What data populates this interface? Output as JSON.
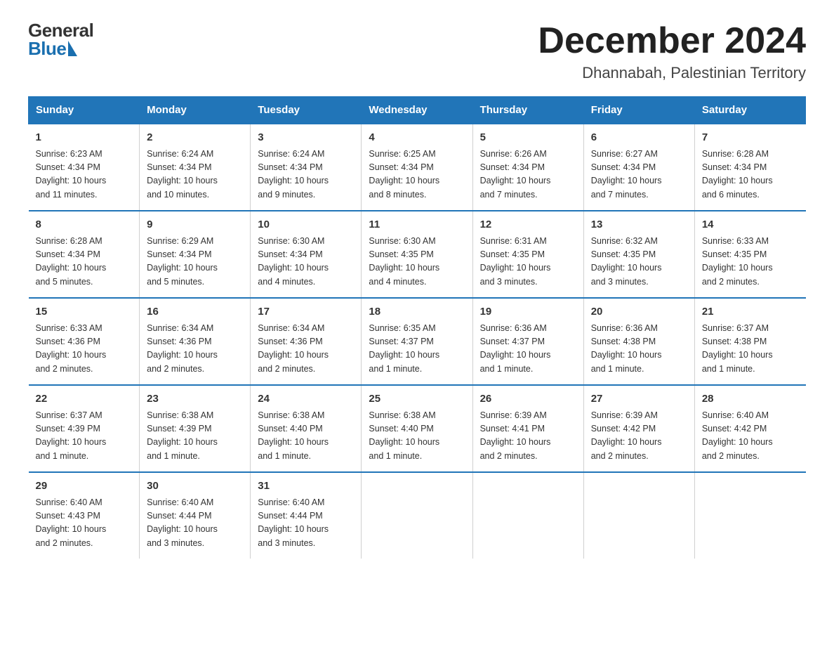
{
  "header": {
    "logo_general": "General",
    "logo_blue": "Blue",
    "month_title": "December 2024",
    "location": "Dhannabah, Palestinian Territory"
  },
  "days_of_week": [
    "Sunday",
    "Monday",
    "Tuesday",
    "Wednesday",
    "Thursday",
    "Friday",
    "Saturday"
  ],
  "weeks": [
    [
      {
        "day": "1",
        "sunrise": "6:23 AM",
        "sunset": "4:34 PM",
        "daylight": "10 hours and 11 minutes."
      },
      {
        "day": "2",
        "sunrise": "6:24 AM",
        "sunset": "4:34 PM",
        "daylight": "10 hours and 10 minutes."
      },
      {
        "day": "3",
        "sunrise": "6:24 AM",
        "sunset": "4:34 PM",
        "daylight": "10 hours and 9 minutes."
      },
      {
        "day": "4",
        "sunrise": "6:25 AM",
        "sunset": "4:34 PM",
        "daylight": "10 hours and 8 minutes."
      },
      {
        "day": "5",
        "sunrise": "6:26 AM",
        "sunset": "4:34 PM",
        "daylight": "10 hours and 7 minutes."
      },
      {
        "day": "6",
        "sunrise": "6:27 AM",
        "sunset": "4:34 PM",
        "daylight": "10 hours and 7 minutes."
      },
      {
        "day": "7",
        "sunrise": "6:28 AM",
        "sunset": "4:34 PM",
        "daylight": "10 hours and 6 minutes."
      }
    ],
    [
      {
        "day": "8",
        "sunrise": "6:28 AM",
        "sunset": "4:34 PM",
        "daylight": "10 hours and 5 minutes."
      },
      {
        "day": "9",
        "sunrise": "6:29 AM",
        "sunset": "4:34 PM",
        "daylight": "10 hours and 5 minutes."
      },
      {
        "day": "10",
        "sunrise": "6:30 AM",
        "sunset": "4:34 PM",
        "daylight": "10 hours and 4 minutes."
      },
      {
        "day": "11",
        "sunrise": "6:30 AM",
        "sunset": "4:35 PM",
        "daylight": "10 hours and 4 minutes."
      },
      {
        "day": "12",
        "sunrise": "6:31 AM",
        "sunset": "4:35 PM",
        "daylight": "10 hours and 3 minutes."
      },
      {
        "day": "13",
        "sunrise": "6:32 AM",
        "sunset": "4:35 PM",
        "daylight": "10 hours and 3 minutes."
      },
      {
        "day": "14",
        "sunrise": "6:33 AM",
        "sunset": "4:35 PM",
        "daylight": "10 hours and 2 minutes."
      }
    ],
    [
      {
        "day": "15",
        "sunrise": "6:33 AM",
        "sunset": "4:36 PM",
        "daylight": "10 hours and 2 minutes."
      },
      {
        "day": "16",
        "sunrise": "6:34 AM",
        "sunset": "4:36 PM",
        "daylight": "10 hours and 2 minutes."
      },
      {
        "day": "17",
        "sunrise": "6:34 AM",
        "sunset": "4:36 PM",
        "daylight": "10 hours and 2 minutes."
      },
      {
        "day": "18",
        "sunrise": "6:35 AM",
        "sunset": "4:37 PM",
        "daylight": "10 hours and 1 minute."
      },
      {
        "day": "19",
        "sunrise": "6:36 AM",
        "sunset": "4:37 PM",
        "daylight": "10 hours and 1 minute."
      },
      {
        "day": "20",
        "sunrise": "6:36 AM",
        "sunset": "4:38 PM",
        "daylight": "10 hours and 1 minute."
      },
      {
        "day": "21",
        "sunrise": "6:37 AM",
        "sunset": "4:38 PM",
        "daylight": "10 hours and 1 minute."
      }
    ],
    [
      {
        "day": "22",
        "sunrise": "6:37 AM",
        "sunset": "4:39 PM",
        "daylight": "10 hours and 1 minute."
      },
      {
        "day": "23",
        "sunrise": "6:38 AM",
        "sunset": "4:39 PM",
        "daylight": "10 hours and 1 minute."
      },
      {
        "day": "24",
        "sunrise": "6:38 AM",
        "sunset": "4:40 PM",
        "daylight": "10 hours and 1 minute."
      },
      {
        "day": "25",
        "sunrise": "6:38 AM",
        "sunset": "4:40 PM",
        "daylight": "10 hours and 1 minute."
      },
      {
        "day": "26",
        "sunrise": "6:39 AM",
        "sunset": "4:41 PM",
        "daylight": "10 hours and 2 minutes."
      },
      {
        "day": "27",
        "sunrise": "6:39 AM",
        "sunset": "4:42 PM",
        "daylight": "10 hours and 2 minutes."
      },
      {
        "day": "28",
        "sunrise": "6:40 AM",
        "sunset": "4:42 PM",
        "daylight": "10 hours and 2 minutes."
      }
    ],
    [
      {
        "day": "29",
        "sunrise": "6:40 AM",
        "sunset": "4:43 PM",
        "daylight": "10 hours and 2 minutes."
      },
      {
        "day": "30",
        "sunrise": "6:40 AM",
        "sunset": "4:44 PM",
        "daylight": "10 hours and 3 minutes."
      },
      {
        "day": "31",
        "sunrise": "6:40 AM",
        "sunset": "4:44 PM",
        "daylight": "10 hours and 3 minutes."
      },
      null,
      null,
      null,
      null
    ]
  ],
  "labels": {
    "sunrise": "Sunrise:",
    "sunset": "Sunset:",
    "daylight": "Daylight:"
  }
}
